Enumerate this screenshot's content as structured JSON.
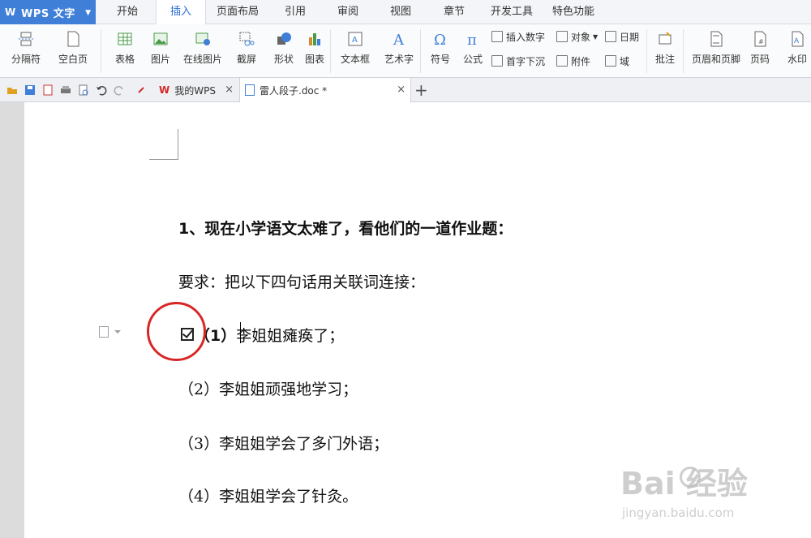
{
  "app": {
    "title": "WPS 文字"
  },
  "menu": {
    "tabs": [
      "开始",
      "插入",
      "页面布局",
      "引用",
      "审阅",
      "视图",
      "章节",
      "开发工具",
      "特色功能"
    ]
  },
  "ribbon": {
    "big": [
      "分隔符",
      "空白页",
      "表格",
      "图片",
      "在线图片",
      "截屏",
      "形状",
      "图表",
      "文本框",
      "艺术字",
      "符号",
      "公式",
      "批注",
      "页眉和页脚",
      "页码",
      "水印"
    ],
    "small": [
      "插入数字",
      "对象",
      "日期",
      "首字下沉",
      "附件",
      "域"
    ]
  },
  "tabs": {
    "docs": [
      "我的WPS",
      "雷人段子.doc *"
    ]
  },
  "doc": {
    "line1": "1、现在小学语文太难了，看他们的一道作业题：",
    "line2": "要求：把以下四句话用关联词连接：",
    "item1_num": "（1）",
    "item1_text": "李姐姐瘫痪了；",
    "item2": "（2）李姐姐顽强地学习；",
    "item3": "（3）李姐姐学会了多门外语；",
    "item4": "（4）李姐姐学会了针灸。"
  },
  "watermark": {
    "main": "Bai  经验",
    "sub": "jingyan.baidu.com"
  },
  "colors": {
    "accent": "#2a6fd3",
    "app_blue": "#3f7fd8",
    "annotation_red": "#d82626"
  }
}
